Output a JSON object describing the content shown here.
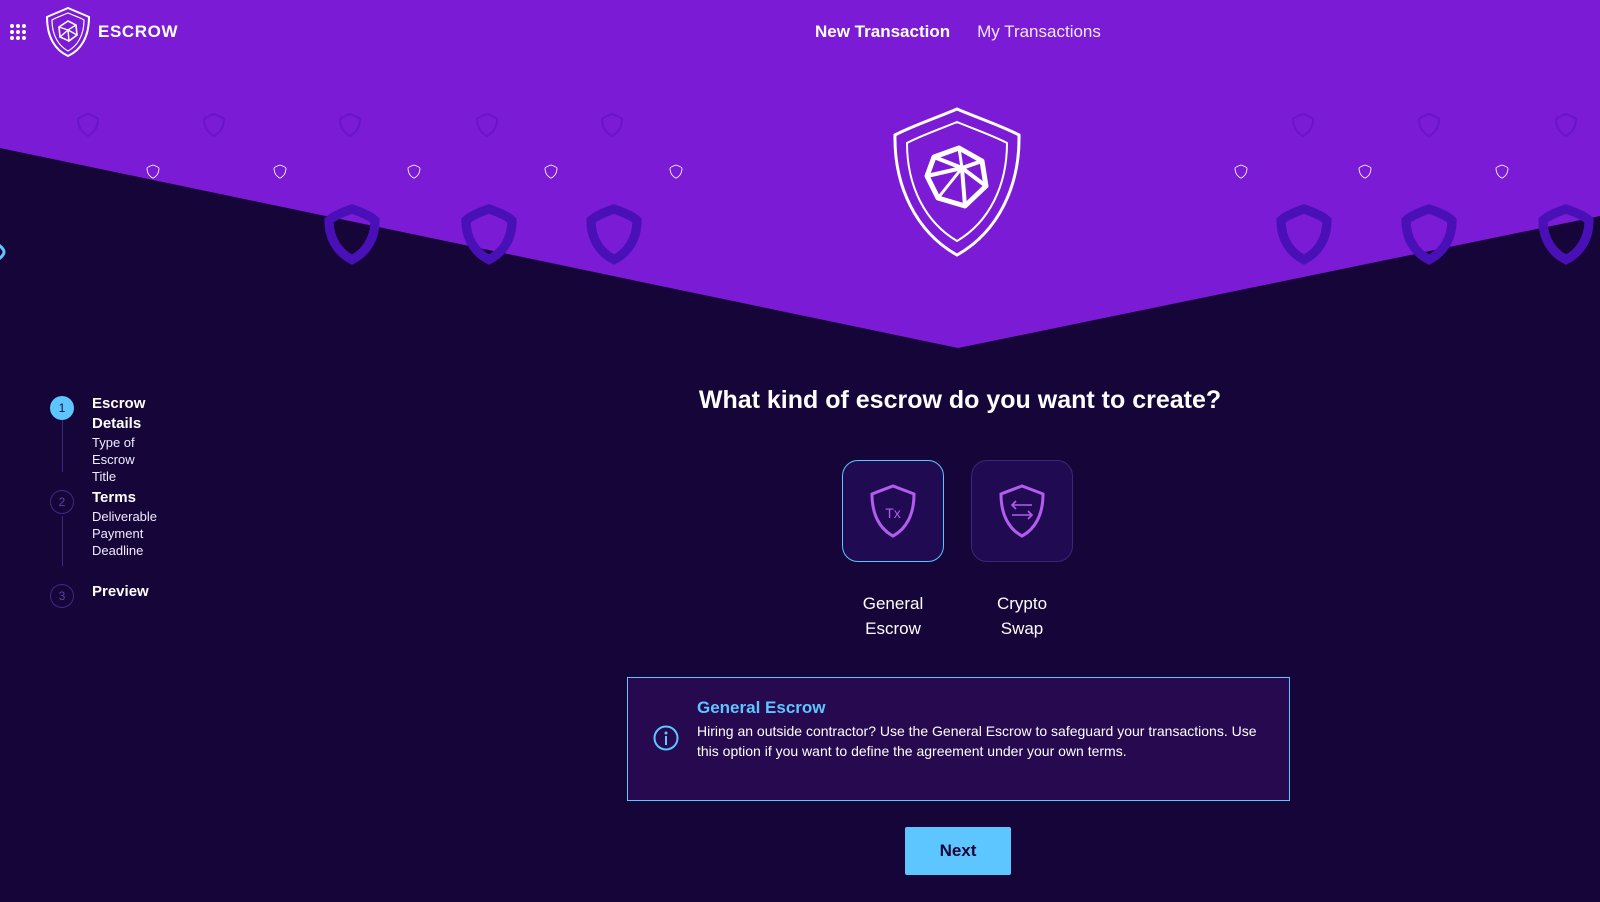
{
  "app": {
    "brand_name": "ESCROW",
    "accent": "#7b1bd6",
    "highlight": "#5ec6ff",
    "background": "#160538"
  },
  "nav": {
    "items": [
      {
        "label": "New Transaction",
        "active": true
      },
      {
        "label": "My Transactions",
        "active": false
      }
    ]
  },
  "stepper": {
    "steps": [
      {
        "number": "1",
        "title": "Escrow Details",
        "subitems": [
          "Type of Escrow",
          "Title"
        ],
        "active": true
      },
      {
        "number": "2",
        "title": "Terms",
        "subitems": [
          "Deliverable",
          "Payment",
          "Deadline"
        ],
        "active": false
      },
      {
        "number": "3",
        "title": "Preview",
        "subitems": [],
        "active": false
      }
    ]
  },
  "main": {
    "question": "What kind of escrow do you want to create?",
    "options": [
      {
        "label_line1": "General",
        "label_line2": "Escrow",
        "icon": "shield-tx-icon",
        "icon_text": "Tx",
        "selected": true
      },
      {
        "label_line1": "Crypto",
        "label_line2": "Swap",
        "icon": "shield-swap-icon",
        "selected": false
      }
    ],
    "info": {
      "title": "General Escrow",
      "text": "Hiring an outside contractor? Use the General Escrow to safeguard your transactions. Use this option if you want to define the agreement under your own terms."
    },
    "next_label": "Next"
  }
}
